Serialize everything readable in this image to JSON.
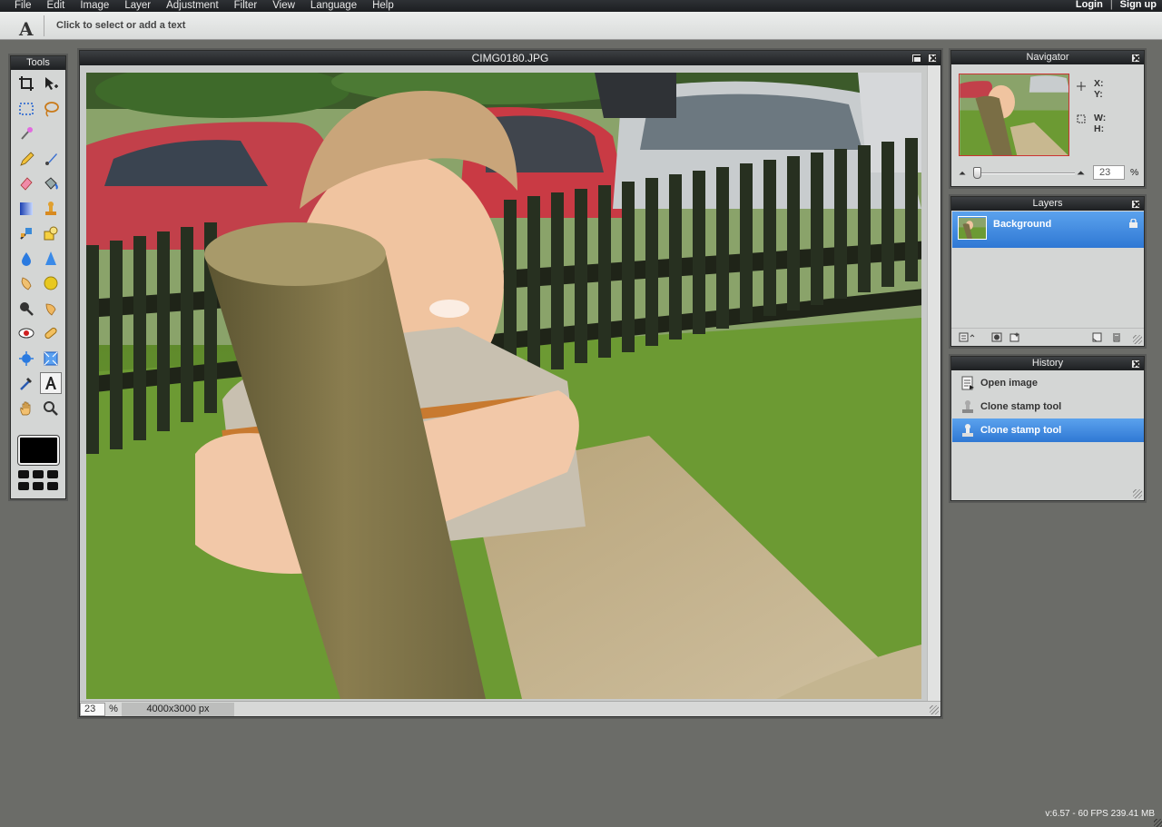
{
  "menubar": {
    "items": [
      "File",
      "Edit",
      "Image",
      "Layer",
      "Adjustment",
      "Filter",
      "View",
      "Language",
      "Help"
    ],
    "login": "Login",
    "separator": "|",
    "signup": "Sign up"
  },
  "options": {
    "tool_glyph": "A",
    "hint": "Click to select or add a text"
  },
  "tools": {
    "title": "Tools",
    "items": [
      "crop-icon",
      "move-icon",
      "marquee-icon",
      "lasso-icon",
      "magic-wand-icon",
      "pencil-icon",
      "brush-icon",
      "eraser-icon",
      "paint-bucket-icon",
      "gradient-icon",
      "clone-stamp-icon",
      "color-replace-icon",
      "drawing-icon",
      "blur-icon",
      "sharpen-icon",
      "smudge-icon",
      "sponge-icon",
      "burn-icon",
      "dodge-icon",
      "red-eye-icon",
      "spot-heal-icon",
      "bloat-icon",
      "pinch-icon",
      "color-picker-icon",
      "text-icon",
      "hand-icon",
      "zoom-icon"
    ],
    "active": "text-icon",
    "foreground_color": "#000000"
  },
  "document": {
    "title": "CIMG0180.JPG",
    "zoom": "23",
    "zoom_unit": "%",
    "dimensions": "4000x3000 px"
  },
  "navigator": {
    "title": "Navigator",
    "x_label": "X:",
    "y_label": "Y:",
    "w_label": "W:",
    "h_label": "H:",
    "zoom": "23",
    "zoom_unit": "%"
  },
  "layers": {
    "title": "Layers",
    "items": [
      {
        "name": "Background",
        "locked": true
      }
    ]
  },
  "history": {
    "title": "History",
    "items": [
      {
        "label": "Open image",
        "icon": "document-icon",
        "selected": false
      },
      {
        "label": "Clone stamp tool",
        "icon": "clone-stamp-icon",
        "selected": false
      },
      {
        "label": "Clone stamp tool",
        "icon": "clone-stamp-icon",
        "selected": true
      }
    ]
  },
  "status": {
    "version": "v:6.57 - 60 FPS 239.41 MB"
  },
  "colors": {
    "selection": "#3a85e0",
    "workspace": "#6b6c68",
    "panel": "#d4d6d5",
    "titlebar": "#2a2c2f"
  }
}
